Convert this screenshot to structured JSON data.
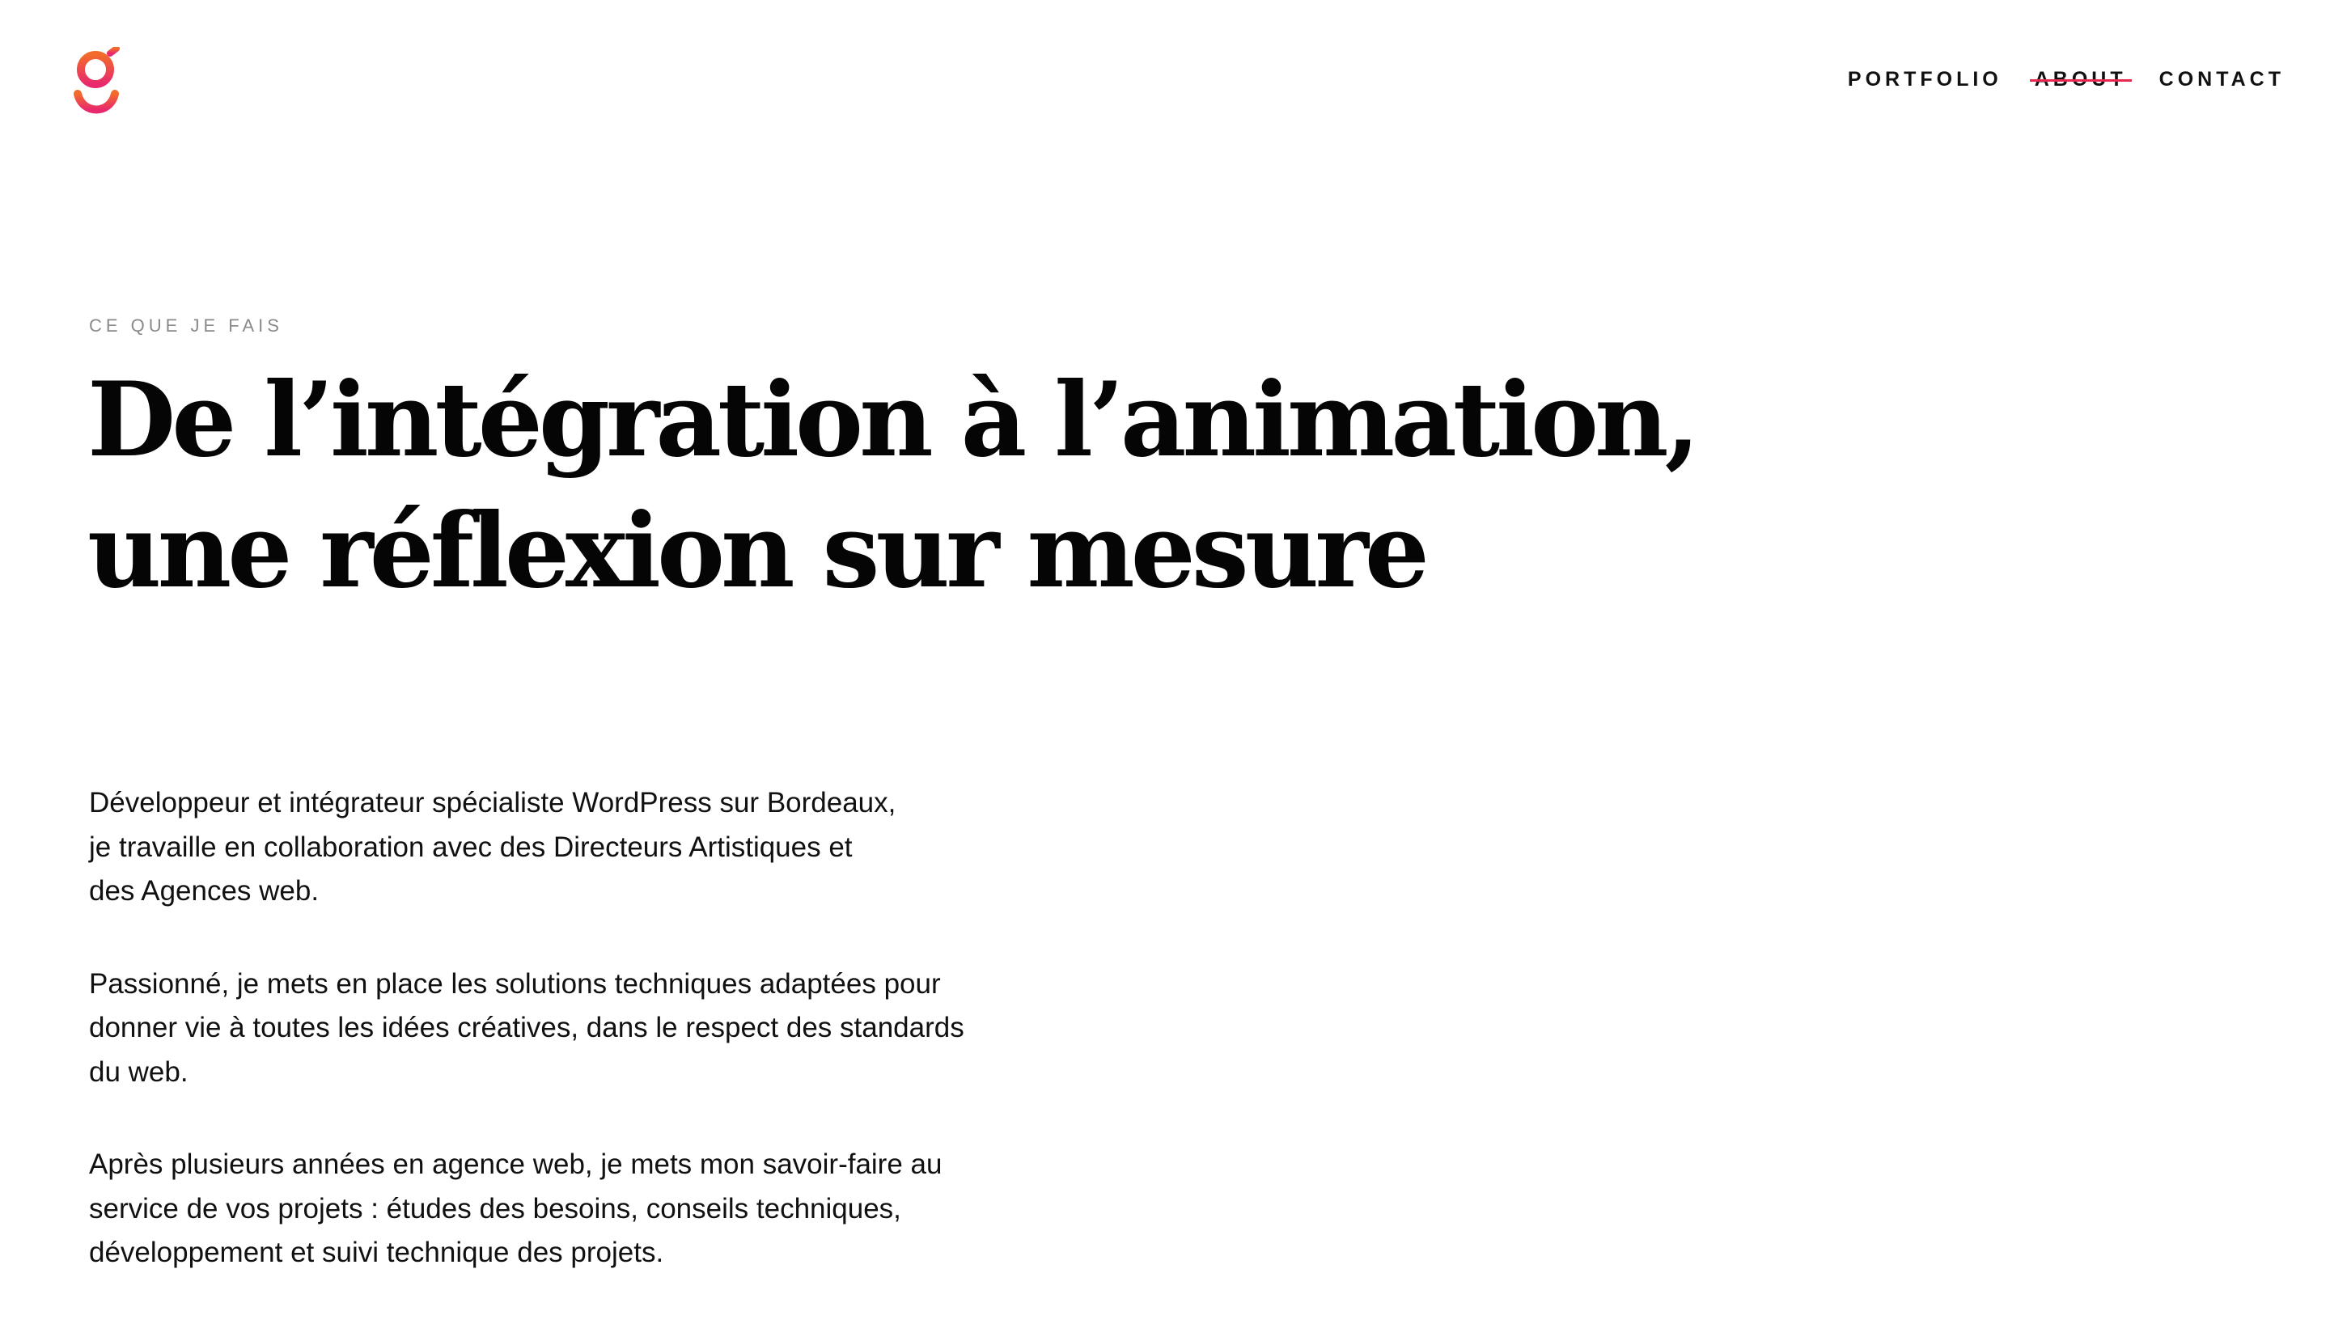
{
  "brand": {
    "logo_icon": "g-letter-logo-icon",
    "gradient_top": "#f26b2b",
    "gradient_bottom": "#e8296e"
  },
  "nav": {
    "items": [
      {
        "label": "PORTFOLIO",
        "active": false
      },
      {
        "label": "ABOUT",
        "active": true
      },
      {
        "label": "CONTACT",
        "active": false
      }
    ],
    "active_strike_color": "#e8294f"
  },
  "hero": {
    "eyebrow": "CE QUE JE FAIS",
    "title_lines": [
      "De l’intégration à l’animation,",
      "une réflexion sur mesure"
    ]
  },
  "paragraphs": [
    {
      "lines": [
        "Développeur et intégrateur spécialiste WordPress sur Bordeaux,",
        "je travaille en collaboration avec des Directeurs Artistiques et",
        "des Agences web."
      ]
    },
    {
      "lines": [
        "Passionné, je mets en place les solutions techniques adaptées pour",
        "donner vie à toutes les idées créatives, dans le respect des standards",
        "du web."
      ]
    },
    {
      "lines": [
        "Après plusieurs années en agence web, je mets mon savoir-faire au",
        "service de vos projets : études des besoins, conseils techniques,",
        "développement et suivi technique des projets."
      ]
    }
  ]
}
